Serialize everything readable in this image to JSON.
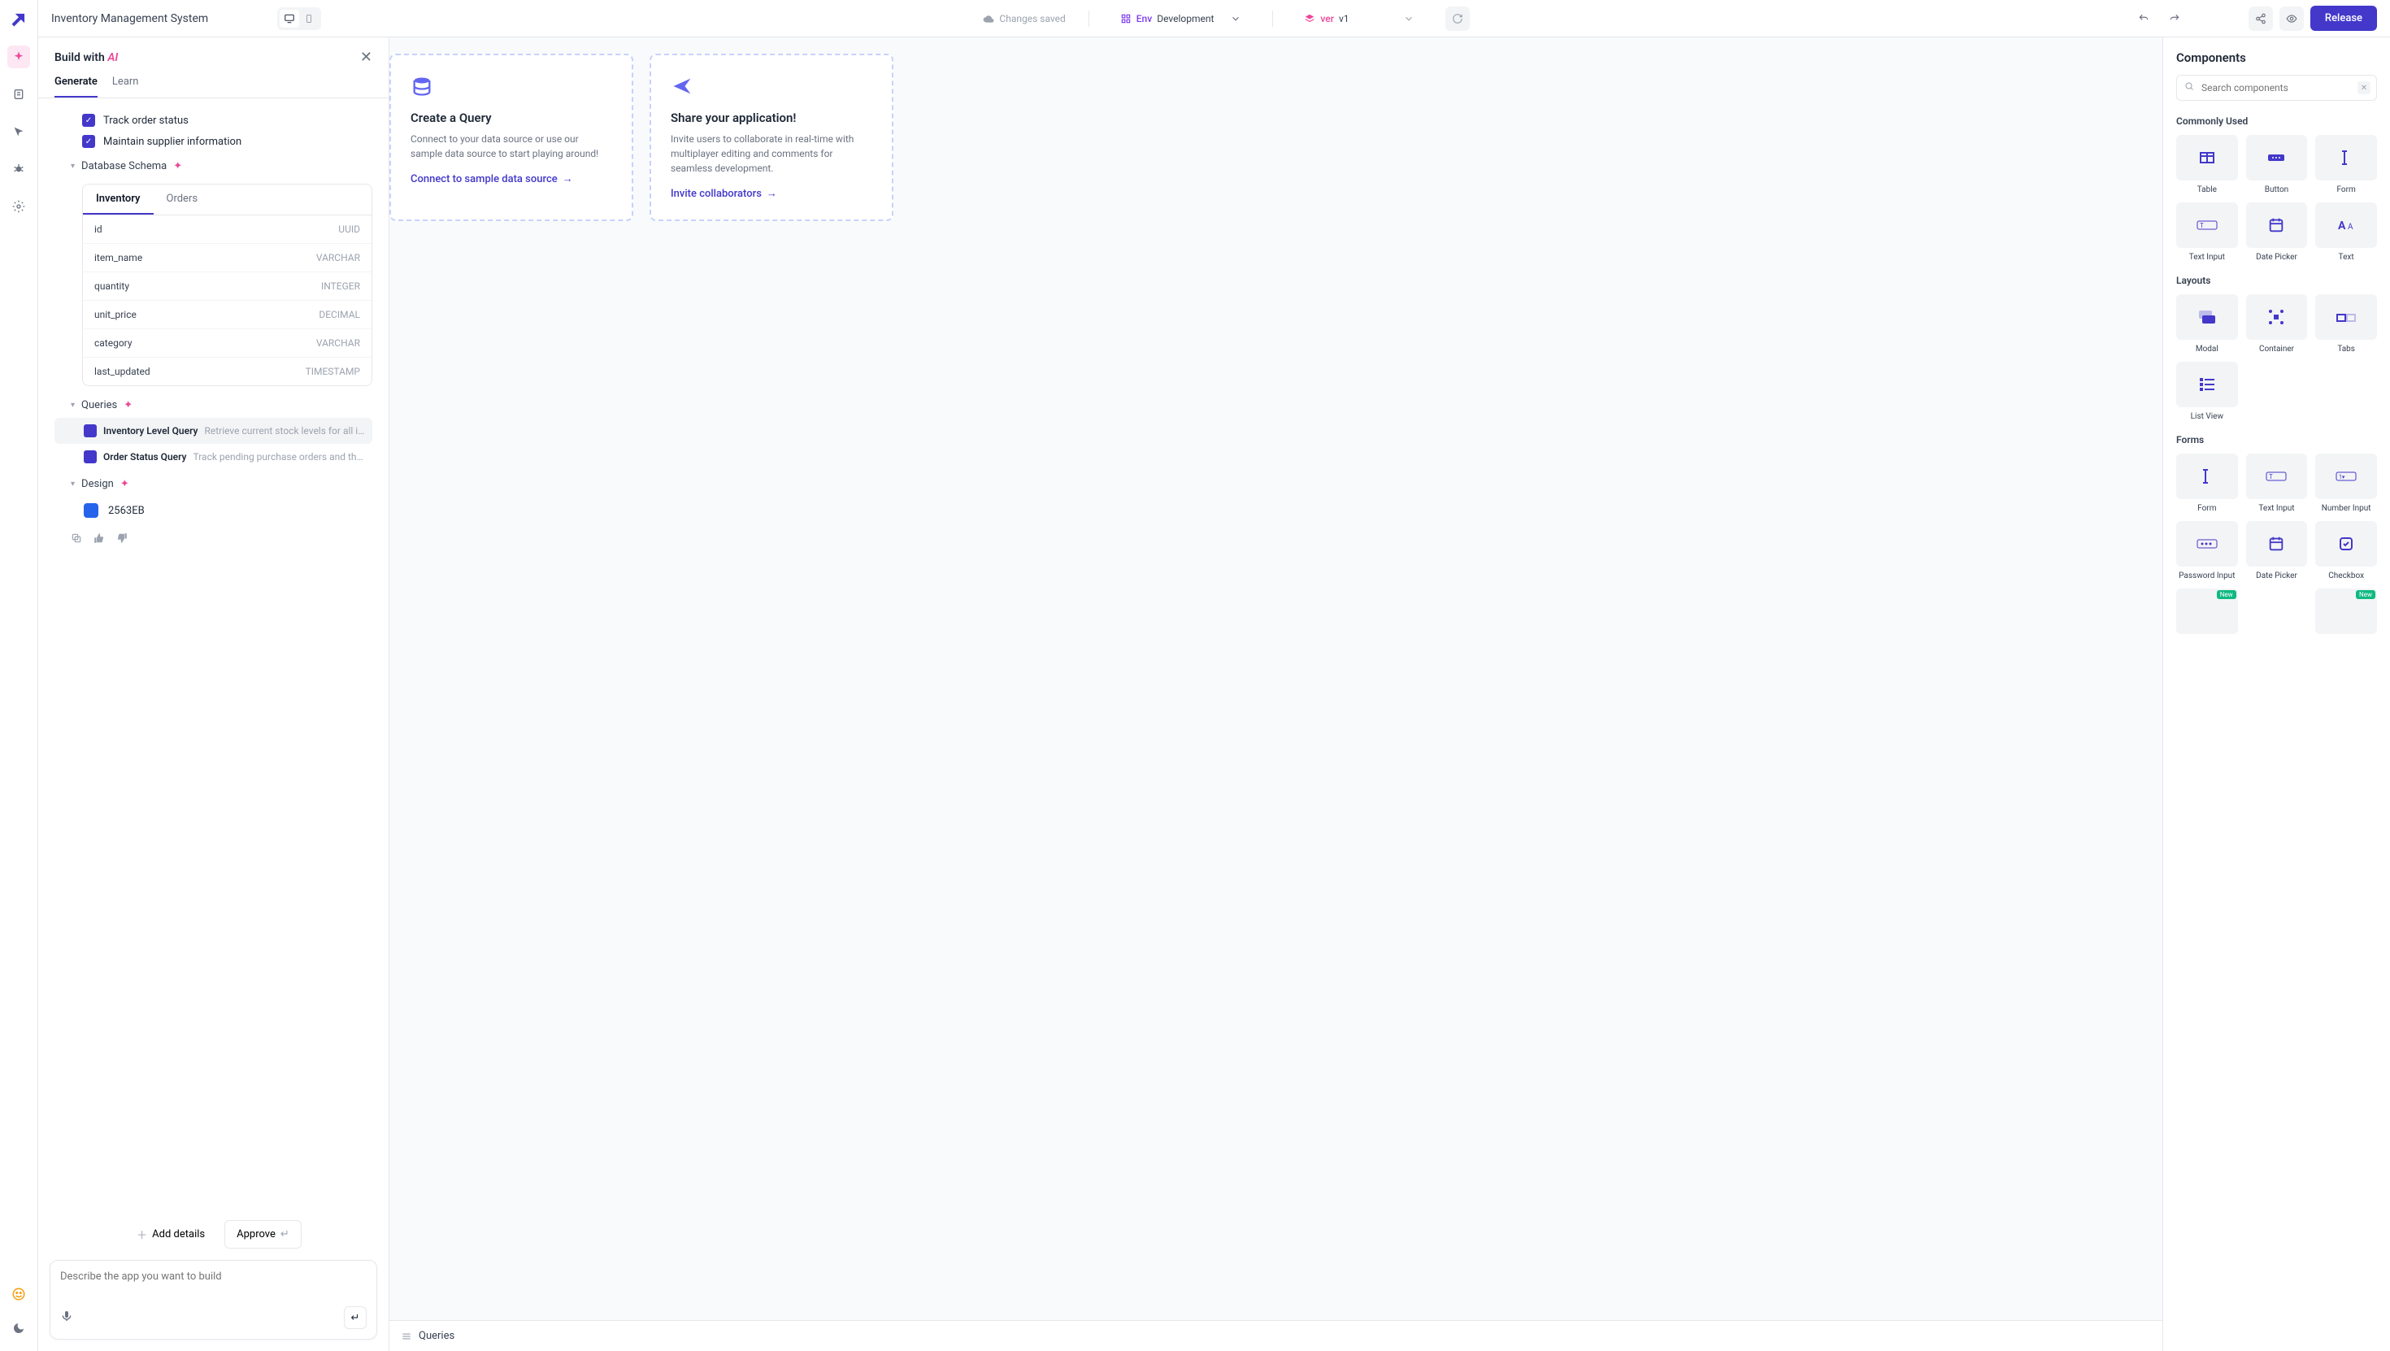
{
  "header": {
    "app_title": "Inventory Management System",
    "changes_saved": "Changes saved",
    "env_label": "Env",
    "env_value": "Development",
    "ver_label": "ver",
    "ver_value": "v1",
    "release": "Release"
  },
  "ai_panel": {
    "title_prefix": "Build with ",
    "title_ai": "AI",
    "tabs": {
      "generate": "Generate",
      "learn": "Learn"
    },
    "checks": {
      "track_order": "Track order status",
      "supplier": "Maintain supplier information"
    },
    "sections": {
      "db_schema": "Database Schema",
      "queries": "Queries",
      "design": "Design"
    },
    "schema_tabs": {
      "inventory": "Inventory",
      "orders": "Orders"
    },
    "schema_rows": [
      {
        "name": "id",
        "type": "UUID"
      },
      {
        "name": "item_name",
        "type": "VARCHAR"
      },
      {
        "name": "quantity",
        "type": "INTEGER"
      },
      {
        "name": "unit_price",
        "type": "DECIMAL"
      },
      {
        "name": "category",
        "type": "VARCHAR"
      },
      {
        "name": "last_updated",
        "type": "TIMESTAMP"
      }
    ],
    "query_items": [
      {
        "name": "Inventory Level Query",
        "desc": "Retrieve current stock levels for all it…"
      },
      {
        "name": "Order Status Query",
        "desc": "Track pending purchase orders and their …"
      }
    ],
    "design_hex": "2563EB",
    "actions": {
      "add_details": "Add details",
      "approve": "Approve"
    },
    "prompt_placeholder": "Describe the app you want to build"
  },
  "canvas": {
    "cards": [
      {
        "title": "Create a Query",
        "desc": "Connect to your data source or use our sample data source to start playing around!",
        "link": "Connect to sample data source"
      },
      {
        "title": "Share your application!",
        "desc": "Invite users to collaborate in real-time with multiplayer editing and comments for seamless development.",
        "link": "Invite collaborators"
      }
    ],
    "queries_bar": "Queries"
  },
  "components": {
    "title": "Components",
    "search_placeholder": "Search components",
    "sections": {
      "commonly_used": "Commonly Used",
      "layouts": "Layouts",
      "forms": "Forms"
    },
    "commonly_used": [
      "Table",
      "Button",
      "Form",
      "Text Input",
      "Date Picker",
      "Text"
    ],
    "layouts": [
      "Modal",
      "Container",
      "Tabs",
      "List View"
    ],
    "forms": [
      "Form",
      "Text Input",
      "Number Input",
      "Password Input",
      "Date Picker",
      "Checkbox"
    ],
    "new_badge": "New"
  }
}
